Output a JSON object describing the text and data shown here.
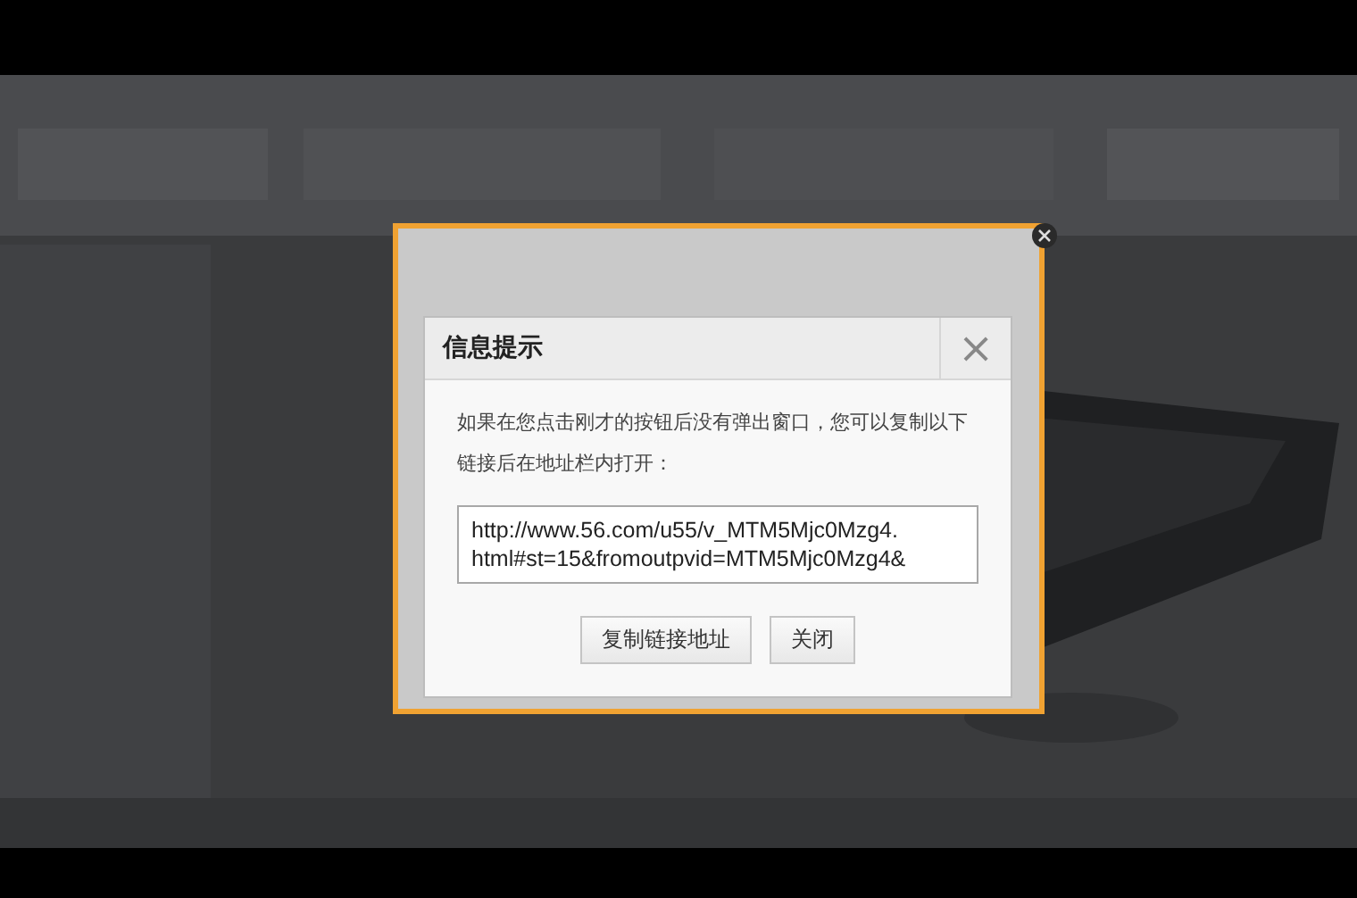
{
  "dialog": {
    "title": "信息提示",
    "close": "×",
    "message": "如果在您点击刚才的按钮后没有弹出窗口，您可以复制以下链接后在地址栏内打开：",
    "url_lines": [
      "http://www.56.com/u55/v_MTM5Mjc0Mzg4.",
      "html#st=15&fromoutpvid=MTM5Mjc0Mzg4&"
    ],
    "buttons": [
      "复制链接地址",
      "关闭"
    ]
  }
}
